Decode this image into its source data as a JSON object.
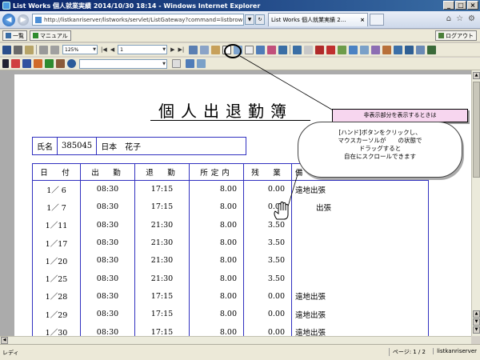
{
  "window": {
    "title": "List Works 個人就業実績 2014/10/30 18:14 - Windows Internet Explorer",
    "controls": [
      "_",
      "□",
      "×"
    ]
  },
  "browser": {
    "address": "http://listkanriserver/listworks/servlet/ListGateway?command=listbrow",
    "tab_title": "List Works 個人就業実績 2...",
    "tab_close": "×"
  },
  "app_toolbar": {
    "list_button": "一覧",
    "manual_button": "マニュアル",
    "logout_button": "ログアウト",
    "zoom": "125%",
    "page_input": "1"
  },
  "document": {
    "title": "個人出退勤簿",
    "name_label": "氏名",
    "employee_id": "385045",
    "employee_name": "日本　花子",
    "headers": [
      "日　付",
      "出　勤",
      "退　勤",
      "所定内",
      "残　業",
      "備"
    ],
    "rows": [
      {
        "date": "1／ 6",
        "in": "08:30",
        "out": "17:15",
        "regular": "8.00",
        "overtime": "0.00",
        "note": "遠地出張"
      },
      {
        "date": "1／ 7",
        "in": "08:30",
        "out": "17:15",
        "regular": "8.00",
        "overtime": "0.00",
        "note": "出張"
      },
      {
        "date": "1／11",
        "in": "08:30",
        "out": "21:30",
        "regular": "8.00",
        "overtime": "3.50",
        "note": ""
      },
      {
        "date": "1／17",
        "in": "08:30",
        "out": "21:30",
        "regular": "8.00",
        "overtime": "3.50",
        "note": ""
      },
      {
        "date": "1／20",
        "in": "08:30",
        "out": "21:30",
        "regular": "8.00",
        "overtime": "3.50",
        "note": ""
      },
      {
        "date": "1／25",
        "in": "08:30",
        "out": "21:30",
        "regular": "8.00",
        "overtime": "3.50",
        "note": ""
      },
      {
        "date": "1／28",
        "in": "08:30",
        "out": "17:15",
        "regular": "8.00",
        "overtime": "0.00",
        "note": "遠地出張"
      },
      {
        "date": "1／29",
        "in": "08:30",
        "out": "17:15",
        "regular": "8.00",
        "overtime": "0.00",
        "note": "遠地出張"
      },
      {
        "date": "1／30",
        "in": "08:30",
        "out": "17:15",
        "regular": "8.00",
        "overtime": "0.00",
        "note": "遠地出張"
      }
    ]
  },
  "callout": {
    "heading": "非表示部分を表示するときは",
    "line1": "[ハンド]ボタンをクリックし、",
    "line2": "マウスカーソルが　　の状態で",
    "line3": "ドラッグすると",
    "line4": "自在にスクロールできます"
  },
  "status": {
    "left": "レディ",
    "page": "ページ: 1 / 2",
    "server": "listkanriserver"
  },
  "colors": {
    "table_border": "#3030c0",
    "callout_head_bg": "#f7d6ef"
  }
}
